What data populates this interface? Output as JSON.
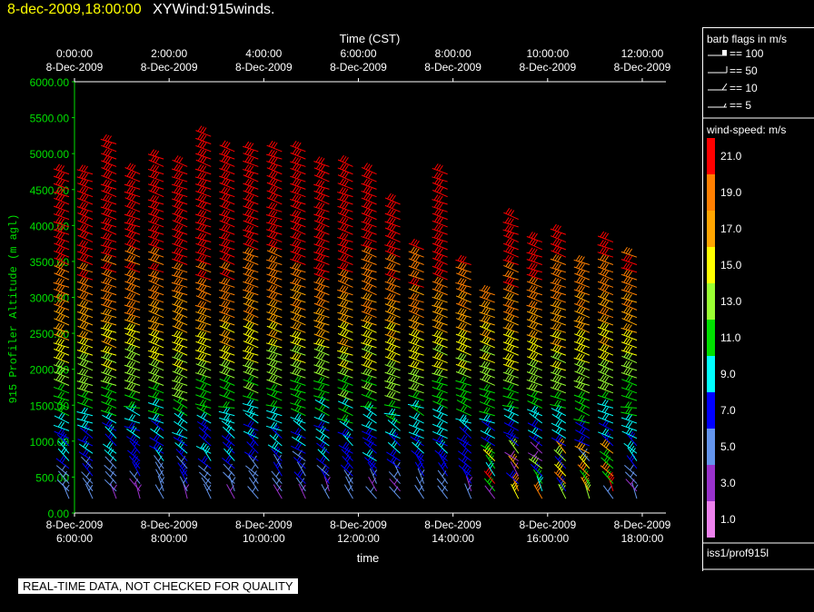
{
  "header": {
    "datetime": "8-dec-2009,18:00:00",
    "title": "XYWind:915winds."
  },
  "footer": {
    "qa_notice": "REAL-TIME DATA, NOT CHECKED FOR QUALITY"
  },
  "legend": {
    "barb_title": "barb flags in m/s",
    "barb_items": [
      "== 100",
      "== 50",
      "== 10",
      "== 5"
    ],
    "speed_title": "wind-speed: m/s",
    "speed_bins": [
      {
        "label": "21.0",
        "color": "#ff0000"
      },
      {
        "label": "19.0",
        "color": "#ff7f00"
      },
      {
        "label": "17.0",
        "color": "#ffa500"
      },
      {
        "label": "15.0",
        "color": "#ffff00"
      },
      {
        "label": "13.0",
        "color": "#9aff32"
      },
      {
        "label": "11.0",
        "color": "#00e000"
      },
      {
        "label": "9.0",
        "color": "#00ffff"
      },
      {
        "label": "7.0",
        "color": "#0000ff"
      },
      {
        "label": "5.0",
        "color": "#6495ed"
      },
      {
        "label": "3.0",
        "color": "#9932cc"
      },
      {
        "label": "1.0",
        "color": "#ee82ee"
      }
    ],
    "source": "iss1/prof915l"
  },
  "chart_data": {
    "type": "wind-barb time-height",
    "top_axis_label": "Time (CST)",
    "top_ticks": [
      {
        "time": "0:00:00",
        "date": "8-Dec-2009"
      },
      {
        "time": "2:00:00",
        "date": "8-Dec-2009"
      },
      {
        "time": "4:00:00",
        "date": "8-Dec-2009"
      },
      {
        "time": "6:00:00",
        "date": "8-Dec-2009"
      },
      {
        "time": "8:00:00",
        "date": "8-Dec-2009"
      },
      {
        "time": "10:00:00",
        "date": "8-Dec-2009"
      },
      {
        "time": "12:00:00",
        "date": "8-Dec-2009"
      }
    ],
    "bottom_axis_label": "time",
    "bottom_ticks": [
      {
        "date": "8-Dec-2009",
        "time": "6:00:00"
      },
      {
        "date": "8-Dec-2009",
        "time": "8:00:00"
      },
      {
        "date": "8-Dec-2009",
        "time": "10:00:00"
      },
      {
        "date": "8-Dec-2009",
        "time": "12:00:00"
      },
      {
        "date": "8-Dec-2009",
        "time": "14:00:00"
      },
      {
        "date": "8-Dec-2009",
        "time": "16:00:00"
      },
      {
        "date": "8-Dec-2009",
        "time": "18:00:00"
      }
    ],
    "ylabel": "915 Profiler Altitude (m agl)",
    "yticks": [
      "0.00",
      "500.00",
      "1000.00",
      "1500.00",
      "2000.00",
      "2500.00",
      "3000.00",
      "3500.00",
      "4000.00",
      "4500.00",
      "5000.00",
      "5500.00",
      "6000.00"
    ],
    "ylim": [
      0,
      6000
    ],
    "xlim_utc_hours": [
      6,
      18.5
    ],
    "profile_times_utc_hours": [
      6.0,
      6.5,
      7.0,
      7.5,
      8.0,
      8.5,
      9.0,
      9.5,
      10.0,
      10.5,
      11.0,
      11.5,
      12.0,
      12.5,
      13.0,
      13.5,
      14.0,
      14.5,
      15.0,
      15.5,
      16.0,
      16.5,
      17.0,
      17.5,
      18.0
    ],
    "profile_top_altitude_m": [
      4720,
      4800,
      5160,
      4780,
      4950,
      4920,
      5320,
      5040,
      5100,
      5120,
      5090,
      4920,
      4880,
      4750,
      4350,
      3720,
      4720,
      3520,
      3120,
      4180,
      3850,
      3900,
      3480,
      3860,
      3560
    ],
    "gate_spacing_m": 105,
    "lowest_gate_m": 200
  }
}
